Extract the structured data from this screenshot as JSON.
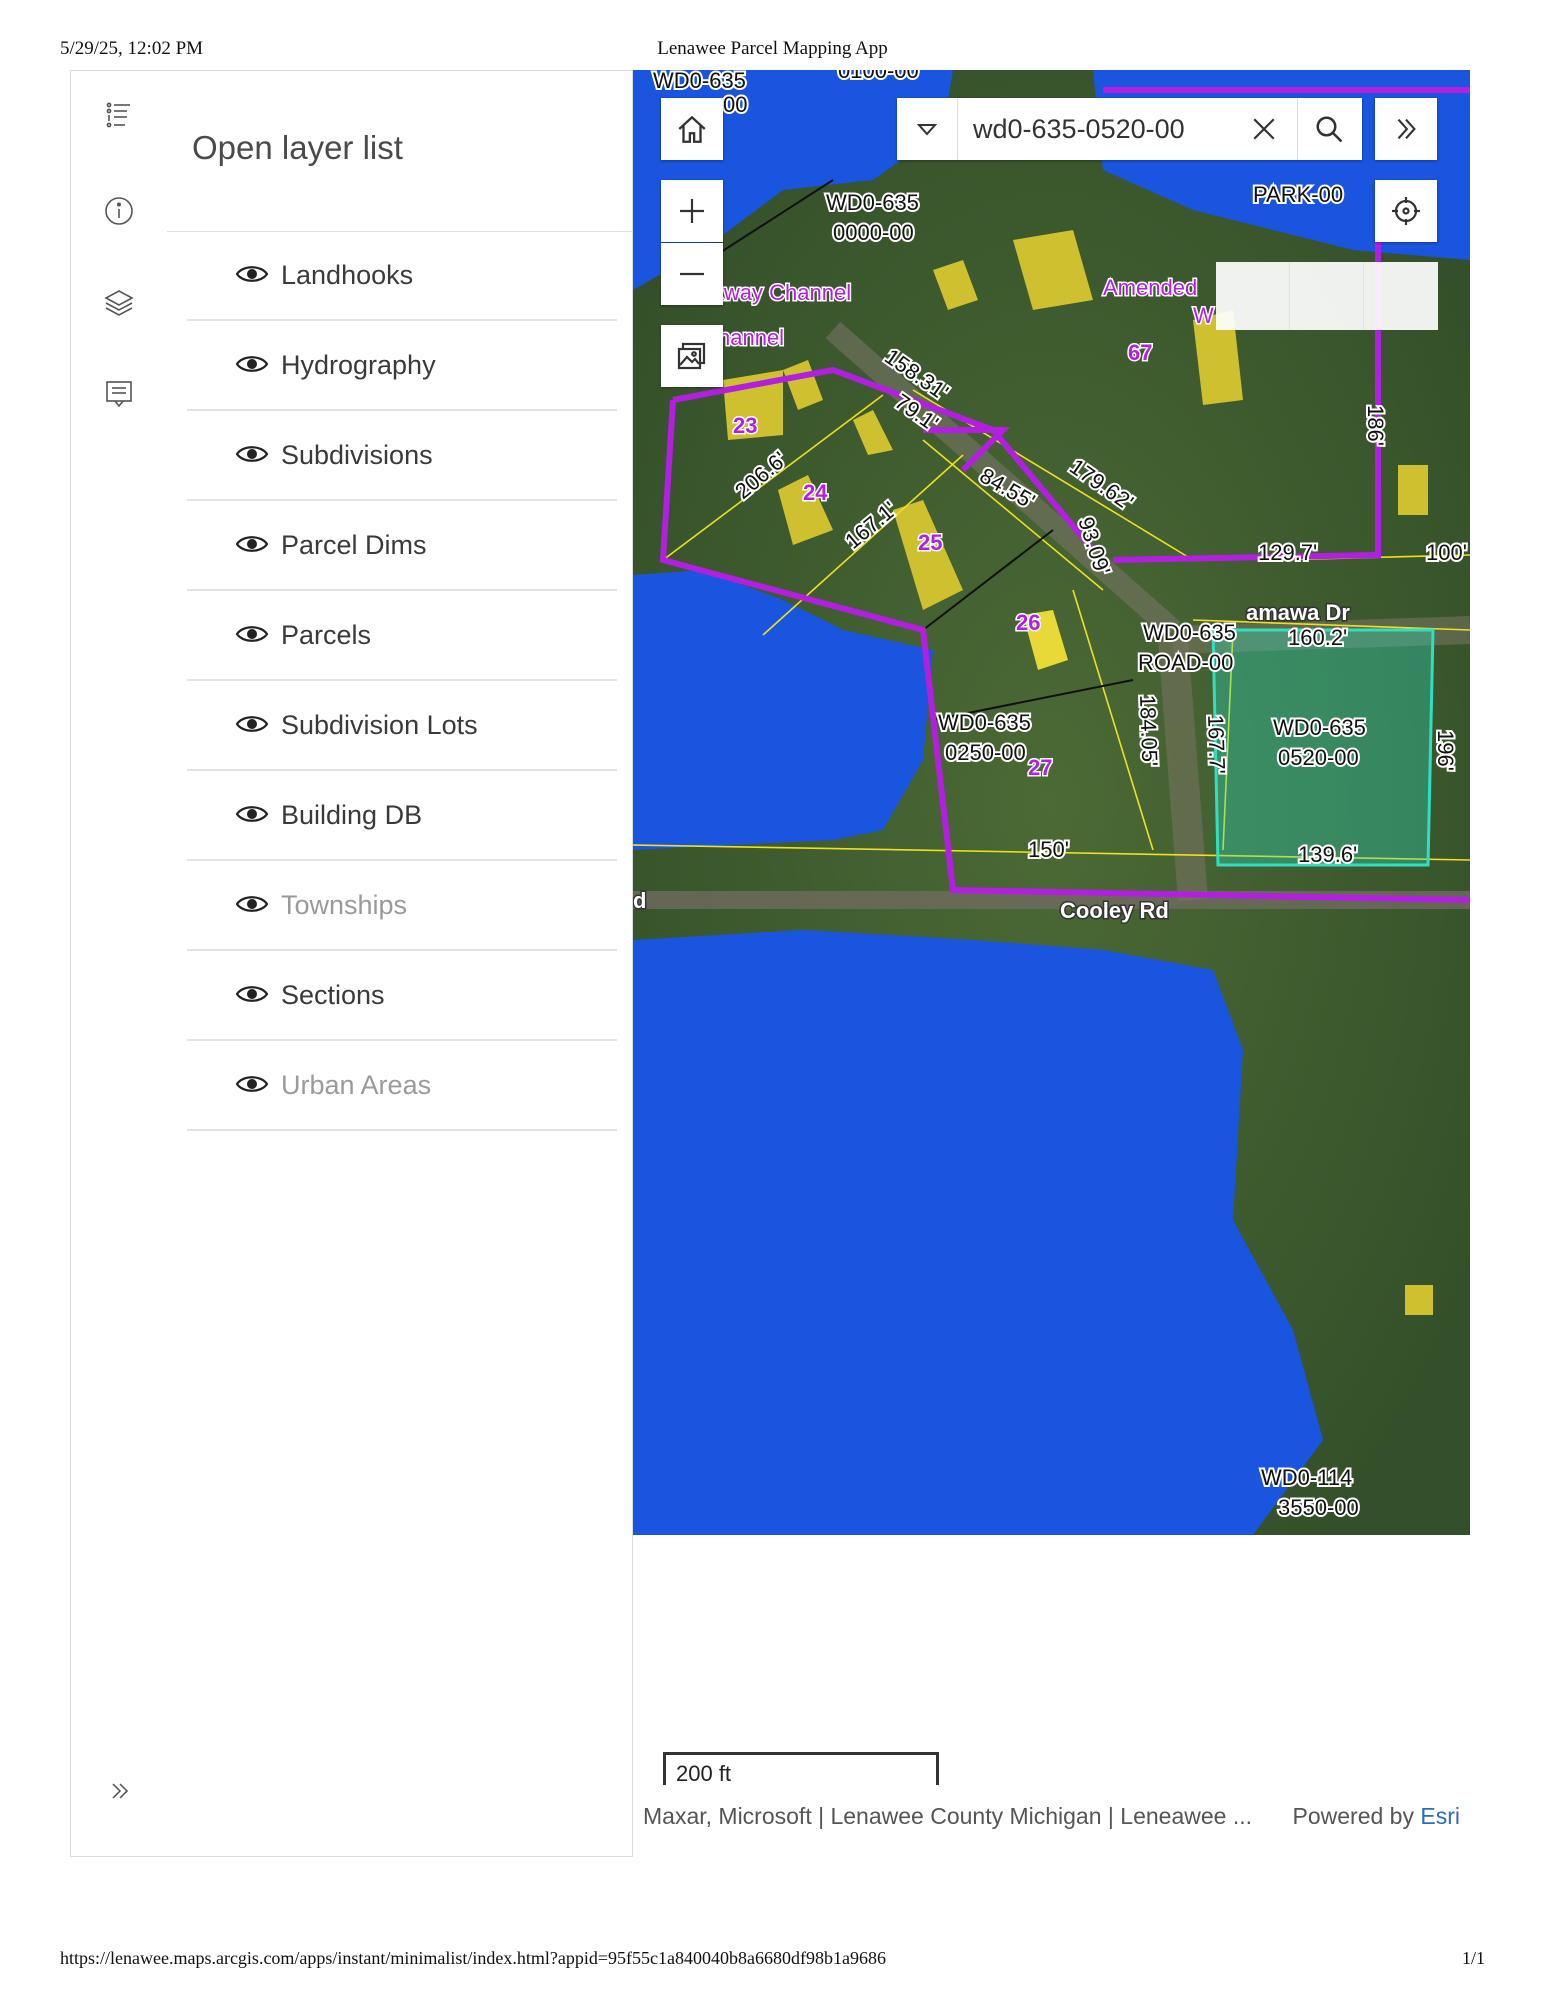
{
  "print": {
    "datetime": "5/29/25, 12:02 PM",
    "page_title": "Lenawee Parcel Mapping App",
    "url": "https://lenawee.maps.arcgis.com/apps/instant/minimalist/index.html?appid=95f55c1a840040b8a6680df98b1a9686",
    "page_number": "1/1"
  },
  "rail": {
    "icons": [
      "legend-icon",
      "info-icon",
      "layers-icon",
      "details-icon",
      "expand-icon"
    ]
  },
  "panel": {
    "title": "Open layer list",
    "layers": [
      {
        "label": "Landhooks",
        "visible": true
      },
      {
        "label": "Hydrography",
        "visible": true
      },
      {
        "label": "Subdivisions",
        "visible": true
      },
      {
        "label": "Parcel Dims",
        "visible": true
      },
      {
        "label": "Parcels",
        "visible": true
      },
      {
        "label": "Subdivision Lots",
        "visible": true
      },
      {
        "label": "Building DB",
        "visible": true
      },
      {
        "label": "Townships",
        "visible": false
      },
      {
        "label": "Sections",
        "visible": true
      },
      {
        "label": "Urban Areas",
        "visible": false
      }
    ]
  },
  "search": {
    "value": "wd0-635-0520-00"
  },
  "map": {
    "labels": {
      "p1": "WD0-635",
      "p1b": "00",
      "p2a": "WD0-635",
      "p2b": "0000-00",
      "park": "PARK-00",
      "channel1": "lkway Channel",
      "channel2": "hannel",
      "amended": "Amended",
      "w": "W",
      "lot67": "67",
      "d186": "186'",
      "lot23": "23",
      "lot24": "24",
      "lot25": "25",
      "lot26": "26",
      "lot27": "27",
      "d158": "158.31'",
      "d79": "79.1'",
      "d84": "84.55'",
      "d179": "179.62'",
      "d206": "206.6'",
      "d167a": "167.1'",
      "d93": "93.09'",
      "road1": "WD0-635",
      "road2": "ROAD-00",
      "d129": "129.7'",
      "d100": "100'",
      "street": "amawa Dr",
      "d160": "160.2'",
      "p250a": "WD0-635",
      "p250b": "0250-00",
      "d184": "184.05'",
      "d167b": "167.7'",
      "sel1": "WD0-635",
      "sel2": "0520-00",
      "d196": "196'",
      "d150": "150'",
      "d139": "139.6'",
      "cooley": "Cooley Rd",
      "dmark": "d",
      "wd114a": "WD0-114",
      "wd114b": "3550-00",
      "top0100": "0100-00",
      "oo": "00"
    },
    "scale": "200 ft",
    "attribution": "Maxar, Microsoft | Lenawee County Michigan | Leneawee ...",
    "powered_by": "Powered by",
    "esri": "Esri"
  },
  "colors": {
    "water": "#1a55e0",
    "parcel_boundary": "#b31fe0",
    "parcel_line": "#f0e020",
    "selection": "#2ee0c0",
    "building": "#cfc030",
    "accent_link": "#2a6ebb"
  }
}
